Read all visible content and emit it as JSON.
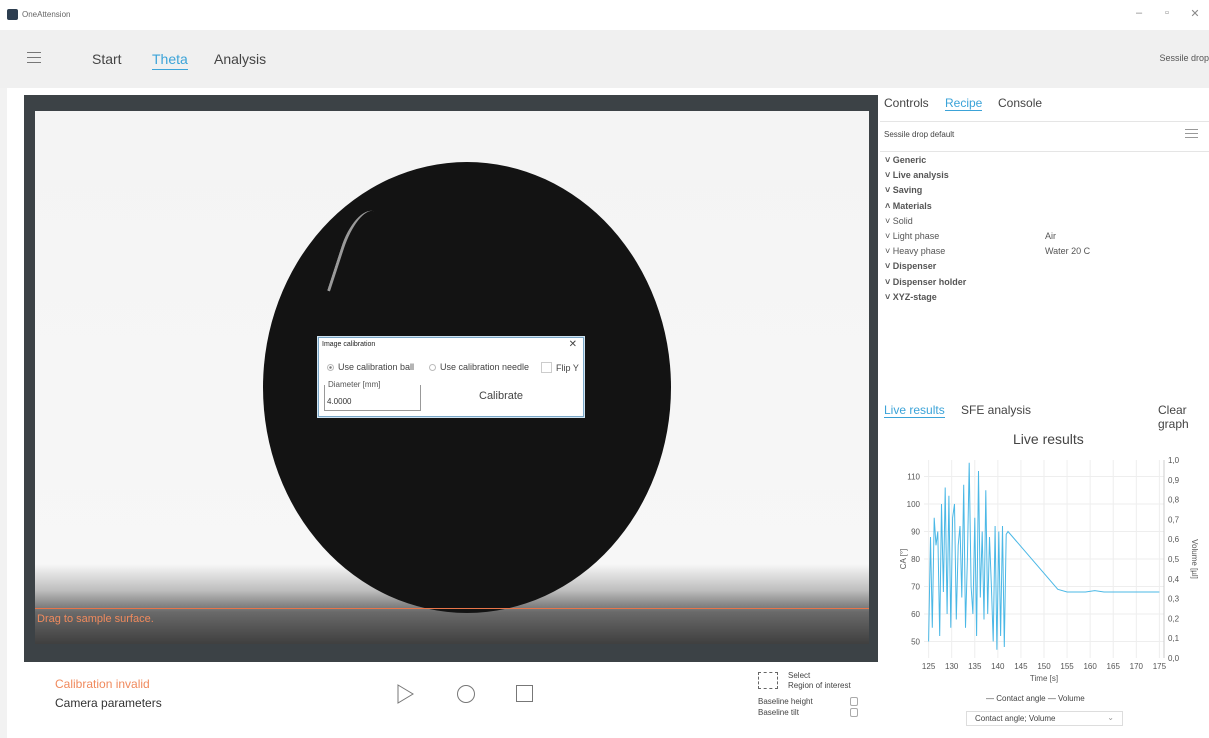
{
  "app": {
    "title": "OneAttension",
    "mode": "Sessile drop"
  },
  "window_controls": {
    "minimize": "–",
    "restore": "▫",
    "close": "✕"
  },
  "nav": {
    "items": [
      "Start",
      "Theta",
      "Analysis"
    ],
    "active": "Theta"
  },
  "camera": {
    "hint": "Drag to sample surface."
  },
  "calibration_dialog": {
    "title": "Image calibration",
    "close": "✕",
    "option_ball": "Use calibration ball",
    "option_needle": "Use calibration needle",
    "flip_y": "Flip Y",
    "diameter_label": "Diameter [mm]",
    "diameter_value": "4.0000",
    "calibrate": "Calibrate"
  },
  "bottom": {
    "calibration_status": "Calibration invalid",
    "camera_parameters": "Camera parameters",
    "select_label": "Select",
    "roi_label": "Region of interest",
    "baseline_height": "Baseline height",
    "baseline_tilt": "Baseline tilt"
  },
  "right_panel": {
    "tabs": [
      "Controls",
      "Recipe",
      "Console"
    ],
    "active_tab": "Recipe",
    "recipe_name": "Sessile drop default",
    "tree": [
      {
        "label": "Generic",
        "bold": true,
        "chev": "˅",
        "value": ""
      },
      {
        "label": "Live analysis",
        "bold": true,
        "chev": "˅",
        "value": ""
      },
      {
        "label": "Saving",
        "bold": true,
        "chev": "˅",
        "value": ""
      },
      {
        "label": "Materials",
        "bold": true,
        "chev": "˄",
        "value": ""
      },
      {
        "label": "Solid",
        "bold": false,
        "chev": "˅",
        "value": ""
      },
      {
        "label": "Light phase",
        "bold": false,
        "chev": "˅",
        "value": "Air"
      },
      {
        "label": "Heavy phase",
        "bold": false,
        "chev": "˅",
        "value": "Water 20 C"
      },
      {
        "label": "Dispenser",
        "bold": true,
        "chev": "˅",
        "value": ""
      },
      {
        "label": "Dispenser holder",
        "bold": true,
        "chev": "˅",
        "value": ""
      },
      {
        "label": "XYZ-stage",
        "bold": true,
        "chev": "˅",
        "value": ""
      }
    ],
    "results_tabs": [
      "Live results",
      "SFE analysis"
    ],
    "active_results_tab": "Live results",
    "clear_graph": "Clear graph",
    "legend": "— Contact angle — Volume",
    "dropdown_value": "Contact angle; Volume"
  },
  "colors": {
    "accent": "#3ba3d8",
    "warning": "#f08a5d",
    "line": "#4bb8e6"
  },
  "chart_data": {
    "type": "line",
    "title": "Live results",
    "xlabel": "Time [s]",
    "ylabel": "CA [°]",
    "y2label": "Volume [µl]",
    "xlim": [
      124,
      176
    ],
    "ylim": [
      44,
      116
    ],
    "y2lim": [
      0,
      1.0
    ],
    "xticks": [
      125,
      130,
      135,
      140,
      145,
      150,
      155,
      160,
      165,
      170,
      175
    ],
    "yticks": [
      50,
      60,
      70,
      80,
      90,
      100,
      110
    ],
    "y2ticks": [
      "0,0",
      "0,1",
      "0,2",
      "0,3",
      "0,4",
      "0,5",
      "0,6",
      "0,7",
      "0,8",
      "0,9",
      "1,0"
    ],
    "series": [
      {
        "name": "Contact angle",
        "x": [
          125.0,
          125.4,
          125.8,
          126.2,
          126.6,
          127.0,
          127.4,
          127.8,
          128.2,
          128.6,
          129.0,
          129.4,
          129.8,
          130.2,
          130.6,
          131.0,
          131.4,
          131.8,
          132.2,
          132.6,
          133.0,
          133.4,
          133.8,
          134.2,
          134.6,
          135.0,
          135.4,
          135.8,
          136.2,
          136.6,
          137.0,
          137.4,
          137.8,
          138.2,
          138.6,
          139.0,
          139.4,
          139.8,
          140.2,
          140.6,
          141.0,
          141.4,
          141.8,
          142.2,
          153.0,
          155.0,
          157.0,
          159.0,
          161.0,
          163.0,
          165.0,
          167.0,
          169.0,
          171.0,
          173.0,
          175.0
        ],
        "y": [
          50,
          88,
          55,
          95,
          85,
          90,
          52,
          100,
          68,
          106,
          60,
          103,
          55,
          95,
          100,
          58,
          85,
          92,
          66,
          107,
          55,
          80,
          115,
          70,
          60,
          95,
          52,
          112,
          66,
          90,
          58,
          105,
          60,
          88,
          70,
          50,
          92,
          47,
          90,
          52,
          92,
          48,
          89,
          90,
          69,
          68,
          68,
          68,
          68.5,
          68,
          68,
          68,
          68,
          68,
          68,
          68
        ]
      },
      {
        "name": "Volume",
        "x": [],
        "y": []
      }
    ],
    "legend_position": "bottom",
    "grid": true
  }
}
